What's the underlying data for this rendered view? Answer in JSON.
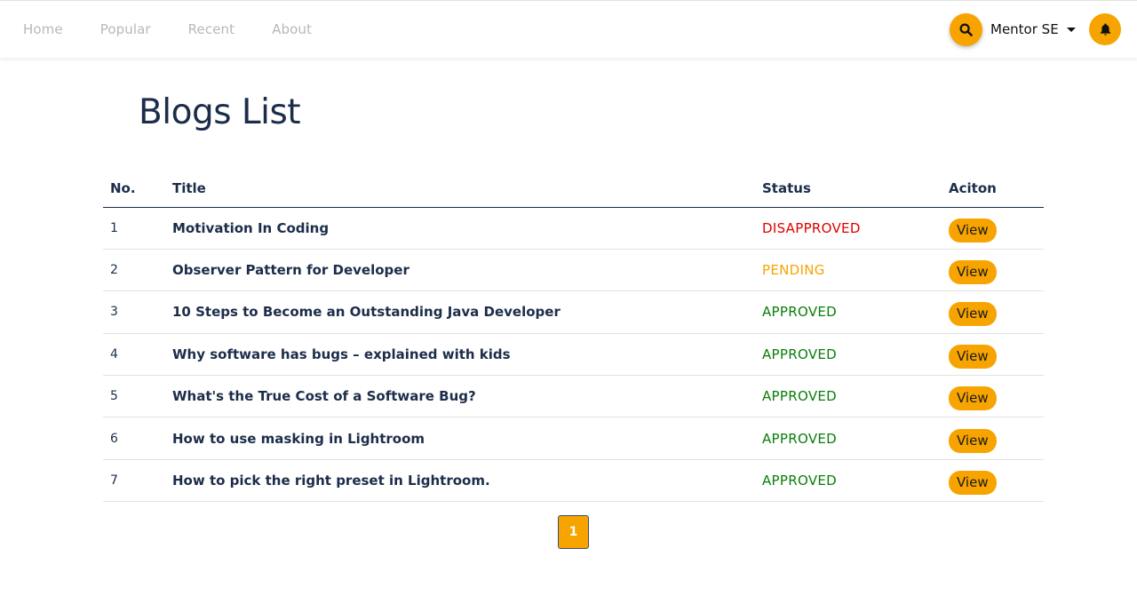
{
  "nav": {
    "links": [
      "Home",
      "Popular",
      "Recent",
      "About"
    ],
    "user_name": "Mentor SE",
    "icons": {
      "search": "search-icon",
      "bell": "bell-icon",
      "dropdown": "caret-down-icon"
    }
  },
  "page": {
    "title": "Blogs List"
  },
  "table": {
    "headers": {
      "no": "No.",
      "title": "Title",
      "status": "Status",
      "action": "Aciton"
    },
    "rows": [
      {
        "no": "1",
        "title": "Motivation In Coding",
        "status": "DISAPPROVED",
        "action": "View"
      },
      {
        "no": "2",
        "title": "Observer Pattern for Developer",
        "status": "PENDING",
        "action": "View"
      },
      {
        "no": "3",
        "title": "10 Steps to Become an Outstanding Java Developer",
        "status": "APPROVED",
        "action": "View"
      },
      {
        "no": "4",
        "title": "Why software has bugs – explained with kids",
        "status": "APPROVED",
        "action": "View"
      },
      {
        "no": "5",
        "title": "What's the True Cost of a Software Bug?",
        "status": "APPROVED",
        "action": "View"
      },
      {
        "no": "6",
        "title": "How to use masking in Lightroom",
        "status": "APPROVED",
        "action": "View"
      },
      {
        "no": "7",
        "title": "How to pick the right preset in Lightroom.",
        "status": "APPROVED",
        "action": "View"
      }
    ]
  },
  "pagination": {
    "current": "1"
  },
  "colors": {
    "accent": "#f7a400",
    "title": "#1c2d4a",
    "disapproved": "#e00000",
    "pending": "#f7a400",
    "approved": "#0a7d0a"
  }
}
